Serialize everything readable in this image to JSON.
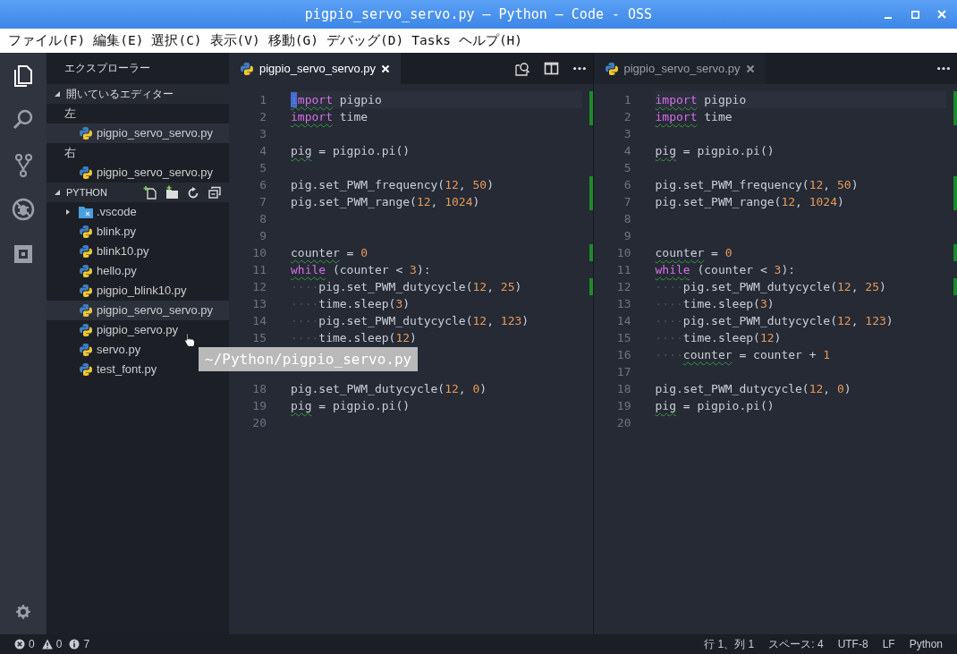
{
  "window": {
    "title": "pigpio_servo_servo.py — Python — Code - OSS",
    "controls": [
      {
        "kind": "minimize"
      },
      {
        "kind": "maximize"
      },
      {
        "kind": "close"
      }
    ]
  },
  "menu": [
    "ファイル(F)",
    "編集(E)",
    "選択(C)",
    "表示(V)",
    "移動(G)",
    "デバッグ(D)",
    "Tasks",
    "ヘルプ(H)"
  ],
  "activity_bar": {
    "items": [
      {
        "kind": "files",
        "selected": true
      },
      {
        "kind": "search",
        "selected": false
      },
      {
        "kind": "git",
        "selected": false
      },
      {
        "kind": "debug",
        "selected": false
      },
      {
        "kind": "extensions",
        "selected": false
      }
    ],
    "bottom": [
      {
        "kind": "settings"
      }
    ]
  },
  "sidebar": {
    "title": "エクスプローラー",
    "open_editors": {
      "title": "開いているエディター",
      "expanded": true,
      "groups": [
        {
          "label": "左",
          "items": [
            {
              "label": "pigpio_servo_servo.py",
              "selected": true
            }
          ]
        },
        {
          "label": "右",
          "items": [
            {
              "label": "pigpio_servo_servo.py",
              "selected": false
            }
          ]
        }
      ]
    },
    "folder": {
      "title": "PYTHON",
      "expanded": true,
      "actions": [
        {
          "kind": "new-file"
        },
        {
          "kind": "new-folder"
        },
        {
          "kind": "refresh"
        },
        {
          "kind": "collapse"
        }
      ],
      "items": [
        {
          "kind": "folder",
          "label": ".vscode",
          "expanded": false,
          "selected": false
        },
        {
          "kind": "python",
          "label": "blink.py",
          "selected": false
        },
        {
          "kind": "python",
          "label": "blink10.py",
          "selected": false
        },
        {
          "kind": "python",
          "label": "hello.py",
          "selected": false
        },
        {
          "kind": "python",
          "label": "pigpio_blink10.py",
          "selected": false
        },
        {
          "kind": "python",
          "label": "pigpio_servo_servo.py",
          "selected": true
        },
        {
          "kind": "python",
          "label": "pigpio_servo.py",
          "selected": false
        },
        {
          "kind": "python",
          "label": "servo.py",
          "selected": false
        },
        {
          "kind": "python",
          "label": "test_font.py",
          "selected": false
        }
      ]
    }
  },
  "editors": [
    {
      "tab": {
        "label": "pigpio_servo_servo.py",
        "selected": true
      },
      "focused": true,
      "actions": [
        {
          "kind": "find-in-files"
        },
        {
          "kind": "split"
        },
        {
          "kind": "more"
        }
      ],
      "lines": [
        {
          "number": "1",
          "current": true,
          "changed": true,
          "tokens": [
            {
              "text": "import",
              "kind": "keyword",
              "warned": true
            },
            {
              "text": " pigpio",
              "kind": "plain"
            }
          ]
        },
        {
          "number": "2",
          "current": false,
          "changed": true,
          "tokens": [
            {
              "text": "import",
              "kind": "keyword",
              "warned": true
            },
            {
              "text": " time",
              "kind": "plain"
            }
          ]
        },
        {
          "number": "3",
          "current": false,
          "changed": false
        },
        {
          "number": "4",
          "current": false,
          "changed": false,
          "tokens": [
            {
              "text": "pig",
              "kind": "plain",
              "warned": true
            },
            {
              "text": " = pigpio.pi()",
              "kind": "plain"
            }
          ]
        },
        {
          "number": "5",
          "current": false,
          "changed": false
        },
        {
          "number": "6",
          "current": false,
          "changed": true,
          "tokens": [
            {
              "text": "pig.set_PWM_frequency(",
              "kind": "plain"
            },
            {
              "text": "12",
              "kind": "number"
            },
            {
              "text": ", ",
              "kind": "plain"
            },
            {
              "text": "50",
              "kind": "number"
            },
            {
              "text": ")",
              "kind": "plain"
            }
          ]
        },
        {
          "number": "7",
          "current": false,
          "changed": true,
          "tokens": [
            {
              "text": "pig.set_PWM_range(",
              "kind": "plain"
            },
            {
              "text": "12",
              "kind": "number"
            },
            {
              "text": ", ",
              "kind": "plain"
            },
            {
              "text": "1024",
              "kind": "number"
            },
            {
              "text": ")",
              "kind": "plain"
            }
          ]
        },
        {
          "number": "8",
          "current": false,
          "changed": false
        },
        {
          "number": "9",
          "current": false,
          "changed": false
        },
        {
          "number": "10",
          "current": false,
          "changed": true,
          "tokens": [
            {
              "text": "counter",
              "kind": "plain",
              "warned": true
            },
            {
              "text": " = ",
              "kind": "plain"
            },
            {
              "text": "0",
              "kind": "number"
            }
          ]
        },
        {
          "number": "11",
          "current": false,
          "changed": false,
          "tokens": [
            {
              "text": "while",
              "kind": "keyword",
              "warned": true
            },
            {
              "text": " (counter < ",
              "kind": "plain"
            },
            {
              "text": "3",
              "kind": "number"
            },
            {
              "text": "):",
              "kind": "plain"
            }
          ]
        },
        {
          "number": "12",
          "current": false,
          "changed": true,
          "tokens": [
            {
              "text": "····",
              "kind": "whitespace"
            },
            {
              "text": "pig.set_PWM_dutycycle(",
              "kind": "plain"
            },
            {
              "text": "12",
              "kind": "number"
            },
            {
              "text": ", ",
              "kind": "plain"
            },
            {
              "text": "25",
              "kind": "number"
            },
            {
              "text": ")",
              "kind": "plain"
            }
          ]
        },
        {
          "number": "13",
          "current": false,
          "changed": false,
          "tokens": [
            {
              "text": "····",
              "kind": "whitespace"
            },
            {
              "text": "time.sleep(",
              "kind": "plain"
            },
            {
              "text": "3",
              "kind": "number"
            },
            {
              "text": ")",
              "kind": "plain"
            }
          ]
        },
        {
          "number": "14",
          "current": false,
          "changed": false,
          "tokens": [
            {
              "text": "····",
              "kind": "whitespace"
            },
            {
              "text": "pig.set_PWM_dutycycle(",
              "kind": "plain"
            },
            {
              "text": "12",
              "kind": "number"
            },
            {
              "text": ", ",
              "kind": "plain"
            },
            {
              "text": "123",
              "kind": "number"
            },
            {
              "text": ")",
              "kind": "plain"
            }
          ]
        },
        {
          "number": "15",
          "current": false,
          "changed": false,
          "tokens": [
            {
              "text": "····",
              "kind": "whitespace"
            },
            {
              "text": "time.sleep(",
              "kind": "plain"
            },
            {
              "text": "12",
              "kind": "number"
            },
            {
              "text": ")",
              "kind": "plain"
            }
          ]
        },
        {
          "covered": true
        },
        {
          "covered": true
        },
        {
          "number": "18",
          "current": false,
          "changed": false,
          "tokens": [
            {
              "text": "pig.set_PWM_dutycycle(",
              "kind": "plain"
            },
            {
              "text": "12",
              "kind": "number"
            },
            {
              "text": ", ",
              "kind": "plain"
            },
            {
              "text": "0",
              "kind": "number"
            },
            {
              "text": ")",
              "kind": "plain"
            }
          ]
        },
        {
          "number": "19",
          "current": false,
          "changed": false,
          "tokens": [
            {
              "text": "pig",
              "kind": "plain",
              "warned": true
            },
            {
              "text": " = pigpio.pi()",
              "kind": "plain"
            }
          ]
        },
        {
          "number": "20",
          "current": false,
          "changed": false
        }
      ]
    },
    {
      "tab": {
        "label": "pigpio_servo_servo.py",
        "selected": false
      },
      "focused": false,
      "actions": [
        {
          "kind": "more"
        }
      ],
      "lines": [
        {
          "number": "1",
          "current": true,
          "changed": true,
          "tokens": [
            {
              "text": "import",
              "kind": "keyword",
              "warned": true
            },
            {
              "text": " pigpio",
              "kind": "plain"
            }
          ]
        },
        {
          "number": "2",
          "current": false,
          "changed": true,
          "tokens": [
            {
              "text": "import",
              "kind": "keyword",
              "warned": true
            },
            {
              "text": " time",
              "kind": "plain"
            }
          ]
        },
        {
          "number": "3",
          "current": false,
          "changed": false
        },
        {
          "number": "4",
          "current": false,
          "changed": false,
          "tokens": [
            {
              "text": "pig",
              "kind": "plain",
              "warned": true
            },
            {
              "text": " = pigpio.pi()",
              "kind": "plain"
            }
          ]
        },
        {
          "number": "5",
          "current": false,
          "changed": false
        },
        {
          "number": "6",
          "current": false,
          "changed": true,
          "tokens": [
            {
              "text": "pig.set_PWM_frequency(",
              "kind": "plain"
            },
            {
              "text": "12",
              "kind": "number"
            },
            {
              "text": ", ",
              "kind": "plain"
            },
            {
              "text": "50",
              "kind": "number"
            },
            {
              "text": ")",
              "kind": "plain"
            }
          ]
        },
        {
          "number": "7",
          "current": false,
          "changed": true,
          "tokens": [
            {
              "text": "pig.set_PWM_range(",
              "kind": "plain"
            },
            {
              "text": "12",
              "kind": "number"
            },
            {
              "text": ", ",
              "kind": "plain"
            },
            {
              "text": "1024",
              "kind": "number"
            },
            {
              "text": ")",
              "kind": "plain"
            }
          ]
        },
        {
          "number": "8",
          "current": false,
          "changed": false
        },
        {
          "number": "9",
          "current": false,
          "changed": false
        },
        {
          "number": "10",
          "current": false,
          "changed": true,
          "tokens": [
            {
              "text": "counter",
              "kind": "plain",
              "warned": true
            },
            {
              "text": " = ",
              "kind": "plain"
            },
            {
              "text": "0",
              "kind": "number"
            }
          ]
        },
        {
          "number": "11",
          "current": false,
          "changed": false,
          "tokens": [
            {
              "text": "while",
              "kind": "keyword",
              "warned": true
            },
            {
              "text": " (counter < ",
              "kind": "plain"
            },
            {
              "text": "3",
              "kind": "number"
            },
            {
              "text": "):",
              "kind": "plain"
            }
          ]
        },
        {
          "number": "12",
          "current": false,
          "changed": true,
          "tokens": [
            {
              "text": "····",
              "kind": "whitespace"
            },
            {
              "text": "pig.set_PWM_dutycycle(",
              "kind": "plain"
            },
            {
              "text": "12",
              "kind": "number"
            },
            {
              "text": ", ",
              "kind": "plain"
            },
            {
              "text": "25",
              "kind": "number"
            },
            {
              "text": ")",
              "kind": "plain"
            }
          ]
        },
        {
          "number": "13",
          "current": false,
          "changed": false,
          "tokens": [
            {
              "text": "····",
              "kind": "whitespace"
            },
            {
              "text": "time.sleep(",
              "kind": "plain"
            },
            {
              "text": "3",
              "kind": "number"
            },
            {
              "text": ")",
              "kind": "plain"
            }
          ]
        },
        {
          "number": "14",
          "current": false,
          "changed": false,
          "tokens": [
            {
              "text": "····",
              "kind": "whitespace"
            },
            {
              "text": "pig.set_PWM_dutycycle(",
              "kind": "plain"
            },
            {
              "text": "12",
              "kind": "number"
            },
            {
              "text": ", ",
              "kind": "plain"
            },
            {
              "text": "123",
              "kind": "number"
            },
            {
              "text": ")",
              "kind": "plain"
            }
          ]
        },
        {
          "number": "15",
          "current": false,
          "changed": false,
          "tokens": [
            {
              "text": "····",
              "kind": "whitespace"
            },
            {
              "text": "time.sleep(",
              "kind": "plain"
            },
            {
              "text": "12",
              "kind": "number"
            },
            {
              "text": ")",
              "kind": "plain"
            }
          ]
        },
        {
          "number": "16",
          "current": false,
          "changed": false,
          "tokens": [
            {
              "text": "····",
              "kind": "whitespace"
            },
            {
              "text": "counter",
              "kind": "plain",
              "warned": true
            },
            {
              "text": " = counter + ",
              "kind": "plain"
            },
            {
              "text": "1",
              "kind": "number"
            }
          ]
        },
        {
          "number": "17",
          "current": false,
          "changed": false
        },
        {
          "number": "18",
          "current": false,
          "changed": false,
          "tokens": [
            {
              "text": "pig.set_PWM_dutycycle(",
              "kind": "plain"
            },
            {
              "text": "12",
              "kind": "number"
            },
            {
              "text": ", ",
              "kind": "plain"
            },
            {
              "text": "0",
              "kind": "number"
            },
            {
              "text": ")",
              "kind": "plain"
            }
          ]
        },
        {
          "number": "19",
          "current": false,
          "changed": false,
          "tokens": [
            {
              "text": "pig",
              "kind": "plain",
              "warned": true
            },
            {
              "text": " = pigpio.pi()",
              "kind": "plain"
            }
          ]
        },
        {
          "number": "20",
          "current": false,
          "changed": false
        }
      ]
    }
  ],
  "tooltip": {
    "text": "~/Python/pigpio_servo.py"
  },
  "status_bar": {
    "left": [
      {
        "kind": "error",
        "text": "0"
      },
      {
        "kind": "warning",
        "text": "0"
      },
      {
        "kind": "info",
        "text": "7"
      }
    ],
    "right": [
      "行 1、列 1",
      "スペース: 4",
      "UTF-8",
      "LF",
      "Python"
    ]
  }
}
